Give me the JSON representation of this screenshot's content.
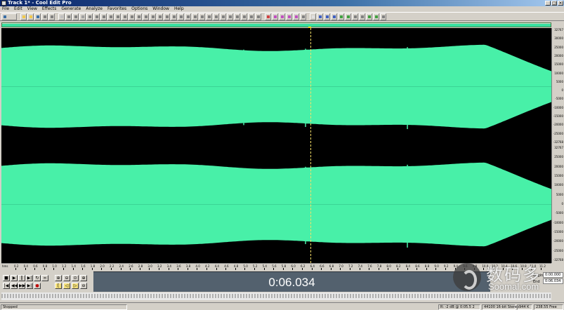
{
  "window": {
    "title": "Track 1* - Cool Edit Pro",
    "buttons": [
      "_",
      "□",
      "×"
    ]
  },
  "menu": [
    "File",
    "Edit",
    "View",
    "Effects",
    "Generate",
    "Analyze",
    "Favorites",
    "Options",
    "Window",
    "Help"
  ],
  "time_display": "0:06.034",
  "ruler": {
    "label": "hms",
    "marks": [
      "0.2",
      "0.4",
      "0.6",
      "0.8",
      "1.0",
      "1.2",
      "1.4",
      "1.6",
      "1.8",
      "2.0",
      "2.2",
      "2.4",
      "2.6",
      "2.8",
      "3.0",
      "3.2",
      "3.4",
      "3.6",
      "3.8",
      "4.0",
      "4.2",
      "4.4",
      "4.6",
      "4.8",
      "5.0",
      "5.2",
      "5.4",
      "5.6",
      "5.8",
      "6.0",
      "6.2",
      "6.4",
      "6.6",
      "6.8",
      "7.0",
      "7.2",
      "7.4",
      "7.6",
      "7.8",
      "8.0",
      "8.2",
      "8.4",
      "8.6",
      "8.8",
      "9.0",
      "9.2",
      "9.4",
      "9.6",
      "9.8",
      "10.0",
      "10.2",
      "10.4",
      "10.6",
      "10.8",
      "11.0",
      "11.2",
      "11.4"
    ]
  },
  "scale": {
    "ch1": [
      "32767",
      "30000",
      "25000",
      "20000",
      "15000",
      "10000",
      "5000",
      "0",
      "-5000",
      "-10000",
      "-15000",
      "-20000",
      "-25000",
      "-32768"
    ],
    "ch2": [
      "32767",
      "25000",
      "20000",
      "15000",
      "10000",
      "5000",
      "0",
      "-5000",
      "-10000",
      "-15000",
      "-20000",
      "-25000",
      "-32768"
    ]
  },
  "selection": {
    "labels": [
      "Begin",
      "End"
    ],
    "begin": "0:00.000",
    "end": "0:06.034"
  },
  "status": {
    "state": "Stopped",
    "level": "R: -2 dB @ 0:05.5 2",
    "format": "44100 16-bit Stereo",
    "size": "944 K",
    "free": "238.55 Free"
  },
  "watermark": {
    "cn": "数码多",
    "en": "Soomal.com"
  },
  "colors": {
    "waveform": "#48f0a8",
    "background": "#000000",
    "cursor": "#ffe066"
  }
}
